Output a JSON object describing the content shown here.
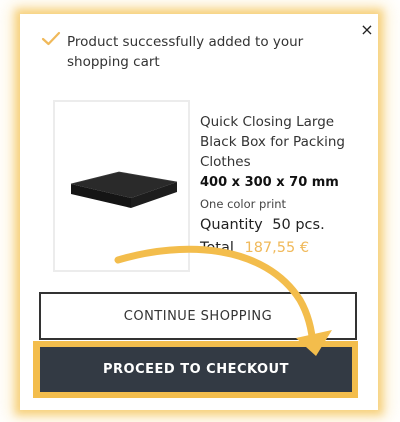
{
  "modal": {
    "success_message": "Product successfully added to your shopping cart",
    "close_symbol": "×"
  },
  "product": {
    "name": "Quick Closing Large Black Box for Packing Clothes",
    "dimensions": "400 x 300 x 70 mm",
    "print_option": "One color print",
    "quantity_label": "Quantity",
    "quantity_value": "50 pcs.",
    "total_label": "Total",
    "total_value": "187,55 €"
  },
  "actions": {
    "continue_label": "CONTINUE SHOPPING",
    "checkout_label": "PROCEED TO CHECKOUT"
  },
  "icons": {
    "check": "check-icon",
    "close": "close-icon",
    "arrow": "curved-arrow-icon"
  },
  "colors": {
    "accent": "#f3bd4c",
    "checkout_bg": "#333a44",
    "price": "#f0b95a"
  }
}
